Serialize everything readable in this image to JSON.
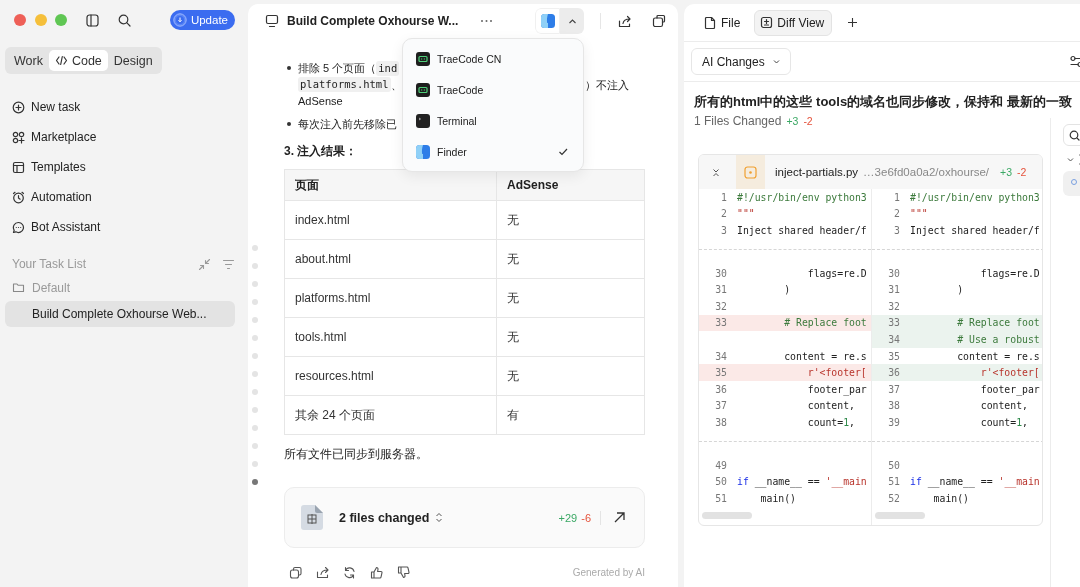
{
  "sidebar": {
    "update_button": "Update",
    "modes": [
      {
        "label": "Work",
        "selected": false
      },
      {
        "label": "Code",
        "selected": true
      },
      {
        "label": "Design",
        "selected": false
      }
    ],
    "nav": [
      "New task",
      "Marketplace",
      "Templates",
      "Automation",
      "Bot Assistant"
    ],
    "task_list": {
      "title": "Your Task List",
      "folder": "Default",
      "tasks": [
        {
          "label": "Build Complete Oxhourse Web...",
          "selected": true
        }
      ]
    }
  },
  "chat": {
    "title": "Build Complete Oxhourse W...",
    "app_menu": [
      {
        "label": "TraeCode CN",
        "selected": false
      },
      {
        "label": "TraeCode",
        "selected": false
      },
      {
        "label": "Terminal",
        "selected": false
      },
      {
        "label": "Finder",
        "selected": true
      }
    ],
    "timeline": [
      {
        "selected": false
      },
      {
        "selected": false
      },
      {
        "selected": false
      },
      {
        "selected": false
      },
      {
        "selected": false
      },
      {
        "selected": false
      },
      {
        "selected": false
      },
      {
        "selected": false
      },
      {
        "selected": false
      },
      {
        "selected": false
      },
      {
        "selected": false
      },
      {
        "selected": false
      },
      {
        "selected": false
      },
      {
        "selected": true
      }
    ],
    "bullets": [
      {
        "lines": [
          [
            [
              {
                "kind": "text",
                "text": "排除 5 个页面（"
              },
              {
                "kind": "code",
                "text": "ind"
              }
            ]
          ],
          [
            [
              {
                "kind": "code",
                "text": "platforms.html"
              },
              {
                "kind": "text",
                "text": "、"
              }
            ],
            [
              {
                "kind": "text",
                "text": "）不注入"
              }
            ]
          ],
          [
            [
              {
                "kind": "text",
                "text": "AdSense"
              }
            ]
          ]
        ]
      },
      {
        "lines": [
          [
            [
              {
                "kind": "text",
                "text": "每次注入前先移除已"
              }
            ]
          ]
        ]
      }
    ],
    "heading": "3. 注入结果：",
    "table": {
      "columns": [
        "页面",
        "AdSense"
      ],
      "rows": [
        [
          "index.html",
          "无"
        ],
        [
          "about.html",
          "无"
        ],
        [
          "platforms.html",
          "无"
        ],
        [
          "tools.html",
          "无"
        ],
        [
          "resources.html",
          "无"
        ],
        [
          "其余 24 个页面",
          "有"
        ]
      ]
    },
    "summary": "所有文件已同步到服务器。",
    "changes_card": {
      "label": "2 files changed",
      "added": "+29",
      "removed": "-6"
    },
    "footer": "Generated by AI"
  },
  "diff": {
    "tabs": [
      {
        "label": "File",
        "selected": false
      },
      {
        "label": "Diff View",
        "selected": true
      }
    ],
    "filter": "AI Changes",
    "title": "所有的html中的这些 tools的域名也同步修改，保持和 最新的一致",
    "files_changed": "1 Files Changed",
    "added": "+3",
    "removed": "-2",
    "file": {
      "name": "inject-partials.py",
      "path": "…3e6fd0a0a2/oxhourse/",
      "added": "+3",
      "removed": "-2",
      "rows": [
        {
          "left": {
            "num": "1",
            "kind": "context",
            "tokens": [
              {
                "text": "#!/usr/bin/env python3",
                "kind": "comment"
              }
            ]
          },
          "right": {
            "num": "1",
            "kind": "context",
            "tokens": [
              {
                "text": "#!/usr/bin/env python3",
                "kind": "comment"
              }
            ]
          }
        },
        {
          "left": {
            "num": "2",
            "kind": "context",
            "tokens": [
              {
                "text": "\"\"\"",
                "kind": "string"
              }
            ]
          },
          "right": {
            "num": "2",
            "kind": "context",
            "tokens": [
              {
                "text": "\"\"\"",
                "kind": "string"
              }
            ]
          }
        },
        {
          "left": {
            "num": "3",
            "kind": "context",
            "tokens": [
              {
                "text": "Inject shared header/f",
                "kind": "plain"
              }
            ]
          },
          "right": {
            "num": "3",
            "kind": "context",
            "tokens": [
              {
                "text": "Inject shared header/f",
                "kind": "plain"
              }
            ]
          }
        },
        {
          "kind": "separator"
        },
        {
          "left": {
            "num": "30",
            "kind": "context",
            "tokens": [
              {
                "text": "            flags=re.D",
                "kind": "plain"
              }
            ]
          },
          "right": {
            "num": "30",
            "kind": "context",
            "tokens": [
              {
                "text": "            flags=re.D",
                "kind": "plain"
              }
            ]
          }
        },
        {
          "left": {
            "num": "31",
            "kind": "context",
            "tokens": [
              {
                "text": "        )",
                "kind": "plain"
              }
            ]
          },
          "right": {
            "num": "31",
            "kind": "context",
            "tokens": [
              {
                "text": "        )",
                "kind": "plain"
              }
            ]
          }
        },
        {
          "left": {
            "num": "32",
            "kind": "context"
          },
          "right": {
            "num": "32",
            "kind": "context"
          }
        },
        {
          "left": {
            "num": "33",
            "kind": "removed",
            "tokens": [
              {
                "text": "        # Replace foot",
                "kind": "comment"
              }
            ]
          },
          "right": {
            "num": "33",
            "kind": "added",
            "tokens": [
              {
                "text": "        # Replace foot",
                "kind": "comment"
              }
            ]
          }
        },
        {
          "right": {
            "num": "34",
            "kind": "added",
            "tokens": [
              {
                "text": "        # Use a robust",
                "kind": "comment"
              }
            ]
          }
        },
        {
          "left": {
            "num": "34",
            "kind": "context",
            "tokens": [
              {
                "text": "        content = re.s",
                "kind": "plain"
              }
            ]
          },
          "right": {
            "num": "35",
            "kind": "context",
            "tokens": [
              {
                "text": "        content = re.s",
                "kind": "plain"
              }
            ]
          }
        },
        {
          "left": {
            "num": "35",
            "kind": "removed",
            "tokens": [
              {
                "text": "            r'<footer[",
                "kind": "string"
              }
            ]
          },
          "right": {
            "num": "36",
            "kind": "added",
            "tokens": [
              {
                "text": "            r'<footer[",
                "kind": "string"
              }
            ]
          }
        },
        {
          "left": {
            "num": "36",
            "kind": "context",
            "tokens": [
              {
                "text": "            footer_par",
                "kind": "plain"
              }
            ]
          },
          "right": {
            "num": "37",
            "kind": "context",
            "tokens": [
              {
                "text": "            footer_par",
                "kind": "plain"
              }
            ]
          }
        },
        {
          "left": {
            "num": "37",
            "kind": "context",
            "tokens": [
              {
                "text": "            content,",
                "kind": "plain"
              }
            ]
          },
          "right": {
            "num": "38",
            "kind": "context",
            "tokens": [
              {
                "text": "            content,",
                "kind": "plain"
              }
            ]
          }
        },
        {
          "left": {
            "num": "38",
            "kind": "context",
            "tokens": [
              {
                "text": "            count=",
                "kind": "plain"
              },
              {
                "text": "1",
                "kind": "number"
              },
              {
                "text": ",",
                "kind": "plain"
              }
            ]
          },
          "right": {
            "num": "39",
            "kind": "context",
            "tokens": [
              {
                "text": "            count=",
                "kind": "plain"
              },
              {
                "text": "1",
                "kind": "number"
              },
              {
                "text": ",",
                "kind": "plain"
              }
            ]
          }
        },
        {
          "kind": "separator"
        },
        {
          "left": {
            "num": "49",
            "kind": "context"
          },
          "right": {
            "num": "50",
            "kind": "context"
          }
        },
        {
          "left": {
            "num": "50",
            "kind": "context",
            "tokens": [
              {
                "text": "if",
                "kind": "keyword"
              },
              {
                "text": " __name__ == ",
                "kind": "plain"
              },
              {
                "text": "'__main",
                "kind": "string"
              }
            ]
          },
          "right": {
            "num": "51",
            "kind": "context",
            "tokens": [
              {
                "text": "if",
                "kind": "keyword"
              },
              {
                "text": " __name__ == ",
                "kind": "plain"
              },
              {
                "text": "'__main",
                "kind": "string"
              }
            ]
          }
        },
        {
          "left": {
            "num": "51",
            "kind": "context",
            "tokens": [
              {
                "text": "    main()",
                "kind": "plain"
              }
            ]
          },
          "right": {
            "num": "52",
            "kind": "context",
            "tokens": [
              {
                "text": "    main()",
                "kind": "plain"
              }
            ]
          }
        }
      ]
    }
  }
}
